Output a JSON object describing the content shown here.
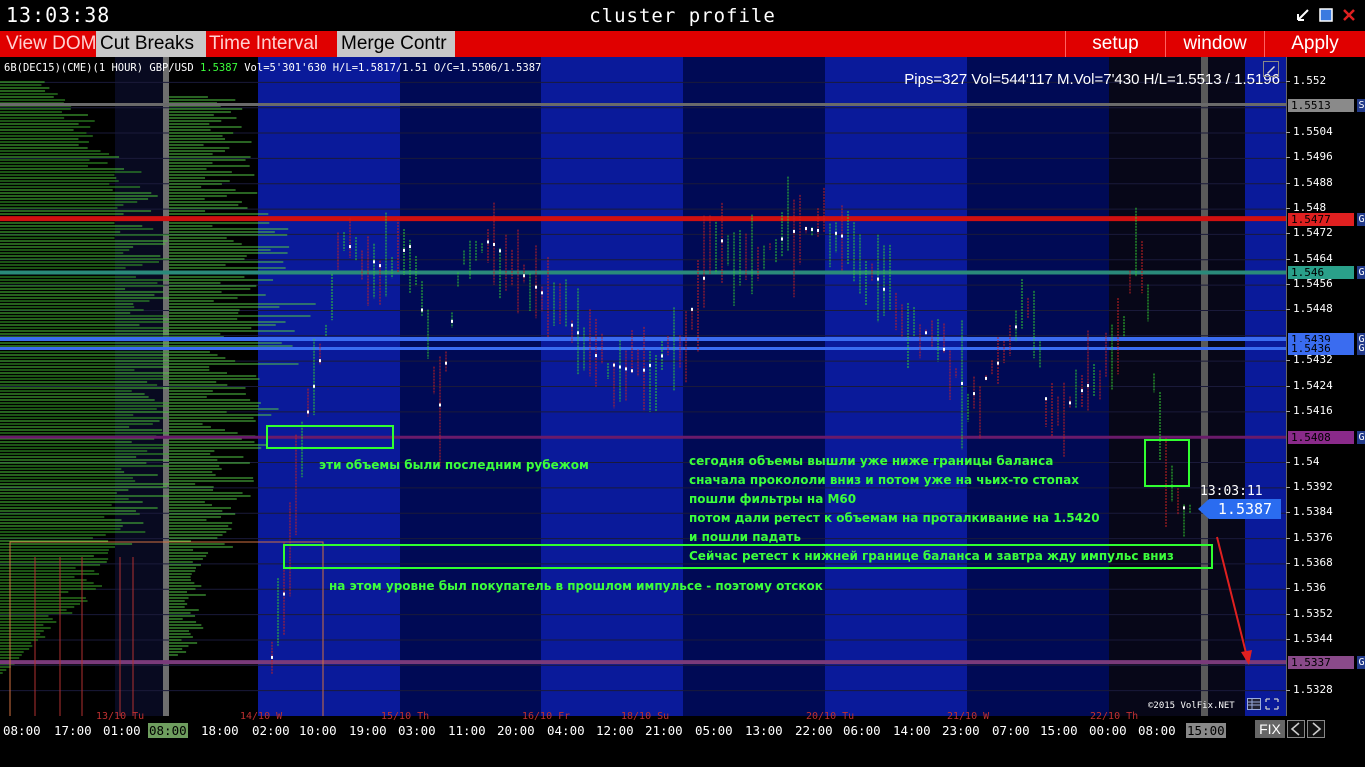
{
  "window": {
    "clock": "13:03:38",
    "title": "cluster profile"
  },
  "toolbar": {
    "view_dom": "View DOM",
    "cut_breaks": "Cut Breaks",
    "time_interval": "Time Interval",
    "merge_contr": "Merge Contr",
    "setup": "setup",
    "window": "window",
    "apply": "Apply"
  },
  "chart": {
    "info_prefix": "6B(DEC15)(CME)(1 HOUR) GBP/USD ",
    "info_last": "1.5387",
    "info_rest": " Vol=5'301'630 H/L=1.5817/1.51 O/C=1.5506/1.5387",
    "info_right": "Pips=327 Vol=544'117 M.Vol=7'430 H/L=1.5513 / 1.5196",
    "current_time": "13:03:11",
    "current_price": "1.5387",
    "copyright": "©2015 VolFix.NET"
  },
  "annotations": {
    "note1": "эти объемы были последним рубежом",
    "note2_l1": "сегодня объемы вышли уже ниже границы баланса",
    "note2_l2": "сначала прокололи вниз и потом уже на чьих-то стопах",
    "note2_l3": "пошли фильтры на М60",
    "note2_l4": "потом дали ретест к  объемам на проталкивание на 1.5420",
    "note2_l5": "и пошли падать",
    "note3": "Сейчас ретест к нижней границе баланса и завтра жду импульс вниз",
    "note4": "на этом уровне был покупатель в прошлом импульсе - поэтому отскок"
  },
  "price_axis": {
    "ticks": [
      "1.552",
      "1.5504",
      "1.5496",
      "1.5488",
      "1.548",
      "1.5472",
      "1.5464",
      "1.5456",
      "1.5448",
      "1.5432",
      "1.5424",
      "1.5416",
      "1.54",
      "1.5392",
      "1.5384",
      "1.5376",
      "1.5368",
      "1.536",
      "1.5352",
      "1.5344",
      "1.5328"
    ],
    "levels": [
      {
        "label": "1.5513",
        "flag": "S",
        "color": "#8a8a8a"
      },
      {
        "label": "1.5477",
        "flag": "G",
        "color": "#e02020"
      },
      {
        "label": "1.546",
        "flag": "G",
        "color": "#2aa08a"
      },
      {
        "label": "1.5439",
        "flag": "G",
        "color": "#3a6cf0"
      },
      {
        "label": "1.5436",
        "flag": "G",
        "color": "#3a6cf0"
      },
      {
        "label": "1.5408",
        "flag": "G",
        "color": "#8a2a8a"
      },
      {
        "label": "1.5337",
        "flag": "G",
        "color": "#8a4a8a"
      }
    ]
  },
  "time_axis": {
    "labels": [
      "08:00",
      "17:00",
      "01:00",
      "08:00",
      "18:00",
      "02:00",
      "10:00",
      "19:00",
      "03:00",
      "11:00",
      "20:00",
      "04:00",
      "12:00",
      "21:00",
      "05:00",
      "13:00",
      "22:00",
      "06:00",
      "14:00",
      "23:00",
      "07:00",
      "15:00",
      "00:00",
      "08:00",
      "15:00"
    ],
    "dates": [
      "13/10 Tu",
      "14/10 W",
      "15/10 Th",
      "16/10 Fr",
      "18/10 Su",
      "20/10 Tu",
      "21/10 W",
      "22/10 Th"
    ],
    "fix": "FIX"
  }
}
